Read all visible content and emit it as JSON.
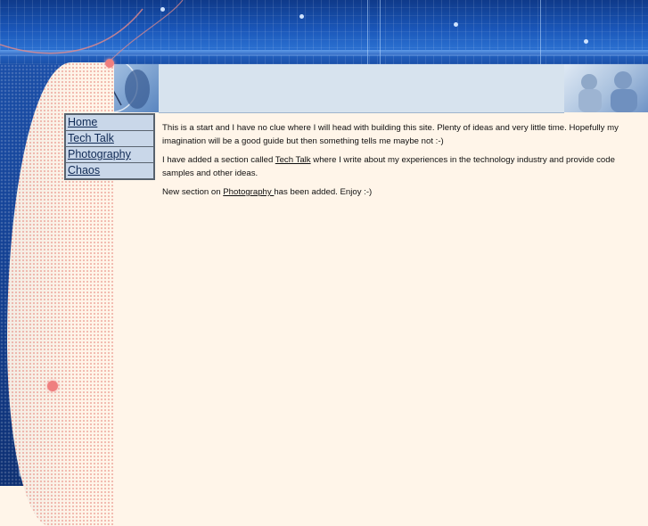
{
  "nav": {
    "items": [
      {
        "label": "Home"
      },
      {
        "label": "Tech Talk"
      },
      {
        "label": "Photography"
      },
      {
        "label": "Chaos"
      }
    ]
  },
  "content": {
    "p1": "This is a start and I have no clue where I will head with building this site. Plenty of ideas and very little time. Hopefully my imagination will be a good guide but then something tells me maybe not :-)",
    "p2_before": "I have added a section called ",
    "p2_link": "Tech Talk",
    "p2_after": " where I write about my experiences in the technology industry and provide code samples and other ideas.",
    "p3_before": "New section on ",
    "p3_link": "Photography ",
    "p3_after": "has been added.  Enjoy :-)"
  },
  "colors": {
    "banner": "#1a56b8",
    "page_bg": "#fff5e9",
    "nav_bg": "#c9d7e9",
    "accent_dot": "#ef7f7f"
  }
}
